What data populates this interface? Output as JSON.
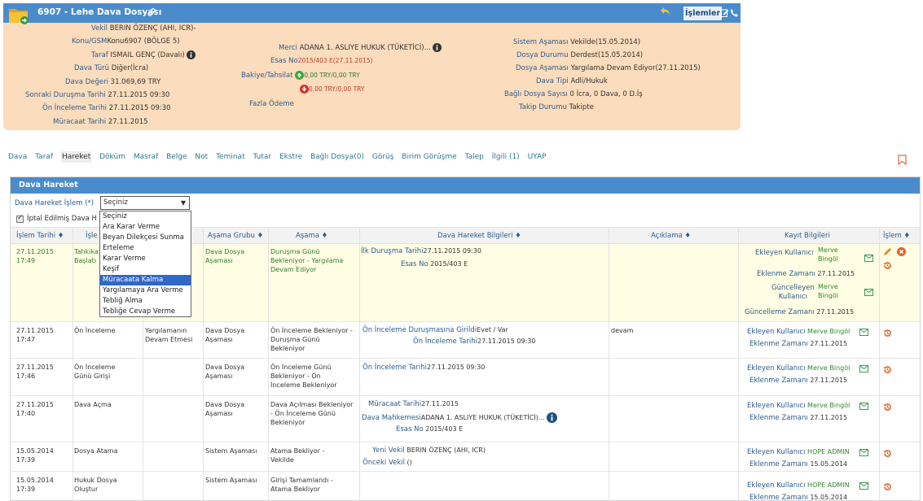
{
  "header": {
    "case_title": "6907 - Lehe Dava Dosyası",
    "actions_label": "İşlemler",
    "col1": [
      {
        "label": "Vekil",
        "value": "BERIN ÖZENÇ (AHI, ICR)-"
      },
      {
        "label": "Konu/GSM",
        "value": "Konu6907 (BÖLGE 5)"
      },
      {
        "label": "Taraf",
        "value": "ISMAIL GENÇ (Davalı)"
      },
      {
        "label": "Dava Türü",
        "value": "Diğer(İcra)"
      },
      {
        "label": "Dava Değeri",
        "value": "31.069,69 TRY"
      },
      {
        "label": "Sonraki Duruşma Tarihi",
        "value": "27.11.2015 09:30"
      },
      {
        "label": "Ön İnceleme Tarihi",
        "value": "27.11.2015 09:30"
      },
      {
        "label": "Müracaat Tarihi",
        "value": "27.11.2015"
      }
    ],
    "col2": {
      "merci_label": "Merci",
      "merci_value": "ADANA 1. ASLIYE HUKUK (TÜKETİCİ)...",
      "esas_label": "Esas No",
      "esas_value": "2015/403 E(27.11.2015)",
      "balance_label": "Bakiye/Tahsilat",
      "balance_1": "0,00 TRY/0,00 TRY",
      "balance_2": "0,00 TRY/0,00 TRY",
      "overpay_label": "Fazla Ödeme"
    },
    "col3": [
      {
        "label": "Sistem Aşaması",
        "value": "Vekilde(15.05.2014)"
      },
      {
        "label": "Dosya Durumu",
        "value": "Derdest(15.05.2014)"
      },
      {
        "label": "Dosya Aşaması",
        "value": "Yargılama Devam Ediyor(27.11.2015)"
      },
      {
        "label": "Dava Tipi",
        "value": "Adli/Hukuk"
      },
      {
        "label": "Bağlı Dosya Sayısı",
        "value": "0 İcra, 0 Dava, 0 D.İş"
      },
      {
        "label": "Takip Durumu",
        "value": "Takipte"
      }
    ]
  },
  "tabs": [
    "Dava",
    "Taraf",
    "Hareket",
    "Döküm",
    "Masraf",
    "Belge",
    "Not",
    "Teminat",
    "Tutar",
    "Ekstre",
    "Bağlı Dosya(0)",
    "Görüş",
    "Birim Görüşme",
    "Talep",
    "İlgili (1)",
    "UYAP"
  ],
  "panel": {
    "title": "Dava Hareket",
    "op_label": "Dava Hareket İşlem (*)",
    "op_selected": "Seçiniz",
    "cancel_label": "İptal Edilmiş Dava H",
    "options": [
      "Seçiniz",
      "Ara Karar Verme",
      "Beyan Dilekçesi Sunma",
      "Erteleme",
      "Karar Verme",
      "Keşif",
      "Müracaata Kalma",
      "Yargılamaya Ara Verme",
      "Tebliğ Alma",
      "Tebliğe Cevap Verme"
    ]
  },
  "table": {
    "headers": [
      "İşlem Tarihi ♦",
      "İşle",
      "Aşama Grubu ♦",
      "Aşama ♦",
      "Dava Hareket Bilgileri ♦",
      "Açıklama ♦",
      "Kayıt Bilgileri",
      "İşlem ♦"
    ],
    "rows": [
      {
        "date": "27.11.2015 17:49",
        "op": "Tahkika Başlatı",
        "reason": "",
        "group": "Dava Dosya Aşaması",
        "stage": "Duruşma Günü Bekleniyor - Yargılama Devam Ediyor",
        "info": [
          {
            "k": "İlk Duruşma Tarihi",
            "v": "27.11.2015 09:30"
          },
          {
            "k": "Esas No",
            "v": "2015/403 E"
          }
        ],
        "desc": "",
        "rec": [
          {
            "k": "Ekleyen Kullanıcı",
            "v": "Merve Bingöl"
          },
          {
            "k": "Eklenme Zamanı",
            "v": "27.11.2015"
          },
          {
            "k": "Güncelleyen Kullanıcı",
            "v": "Merve Bingöl"
          },
          {
            "k": "Güncelleme Zamanı",
            "v": "27.11.2015"
          }
        ]
      },
      {
        "date": "27.11.2015 17:47",
        "op": "Ön İnceleme",
        "reason": "Yargılamanın Devam Etmesi",
        "group": "Dava Dosya Aşaması",
        "stage": "Ön İnceleme Bekleniyor - Duruşma Günü Bekleniyor",
        "info": [
          {
            "k": "Ön İnceleme Duruşmasına Girildi",
            "v": "Evet / Var"
          },
          {
            "k": "Ön İnceleme Tarihi",
            "v": "27.11.2015 09:30"
          }
        ],
        "desc": "devam",
        "rec": [
          {
            "k": "Ekleyen Kullanıcı",
            "v": "Merve Bingöl"
          },
          {
            "k": "Eklenme Zamanı",
            "v": "27.11.2015"
          }
        ]
      },
      {
        "date": "27.11.2015 17:46",
        "op": "Ön İnceleme Günü Girişi",
        "reason": "",
        "group": "Dava Dosya Aşaması",
        "stage": "Ön İnceleme Günü Bekleniyor - Ön İnceleme Bekleniyor",
        "info": [
          {
            "k": "Ön İnceleme Tarihi",
            "v": "27.11.2015 09:30"
          }
        ],
        "desc": "",
        "rec": [
          {
            "k": "Ekleyen Kullanıcı",
            "v": "Merve Bingöl"
          },
          {
            "k": "Eklenme Zamanı",
            "v": "27.11.2015"
          }
        ]
      },
      {
        "date": "27.11.2015 17:40",
        "op": "Dava Açma",
        "reason": "",
        "group": "Dava Dosya Aşaması",
        "stage": "Dava Açılması Bekleniyor - Ön İnceleme Günü Bekleniyor",
        "info": [
          {
            "k": "Müracaat Tarihi",
            "v": "27.11.2015"
          },
          {
            "k": "Dava Mahkemesi",
            "v": "ADANA 1. ASLIYE HUKUK (TÜKETİCİ)..."
          },
          {
            "k": "Esas No",
            "v": "2015/403 E"
          }
        ],
        "desc": "",
        "rec": [
          {
            "k": "Ekleyen Kullanıcı",
            "v": "Merve Bingöl"
          },
          {
            "k": "Eklenme Zamanı",
            "v": "27.11.2015"
          }
        ]
      },
      {
        "date": "15.05.2014 17:39",
        "op": "Dosya Atama",
        "reason": "",
        "group": "Sistem Aşaması",
        "stage": "Atama Bekliyor - Vekilde",
        "info": [
          {
            "k": "Yeni Vekil",
            "v": "BERIN ÖZENÇ (AHI, ICR)"
          },
          {
            "k": "Önceki Vekil",
            "v": "()"
          }
        ],
        "desc": "",
        "rec": [
          {
            "k": "Ekleyen Kullanıcı",
            "v": "HOPE ADMIN"
          },
          {
            "k": "Eklenme Zamanı",
            "v": "15.05.2014"
          }
        ]
      },
      {
        "date": "15.05.2014 17:39",
        "op": "Hukuk Dosya Oluştur",
        "reason": "",
        "group": "Sistem Aşaması",
        "stage": "Girişi Tamamlandı - Atama Bekliyor",
        "info": [],
        "desc": "",
        "rec": [
          {
            "k": "Ekleyen Kullanıcı",
            "v": "HOPE ADMIN"
          },
          {
            "k": "Eklenme Zamanı",
            "v": "15.05.2014"
          }
        ]
      }
    ]
  },
  "colors": {
    "brand_blue": "#4a8ccb",
    "header_bg": "#fbdcbc",
    "highlight_row": "#fffde3",
    "selected_option": "#3168c6"
  }
}
